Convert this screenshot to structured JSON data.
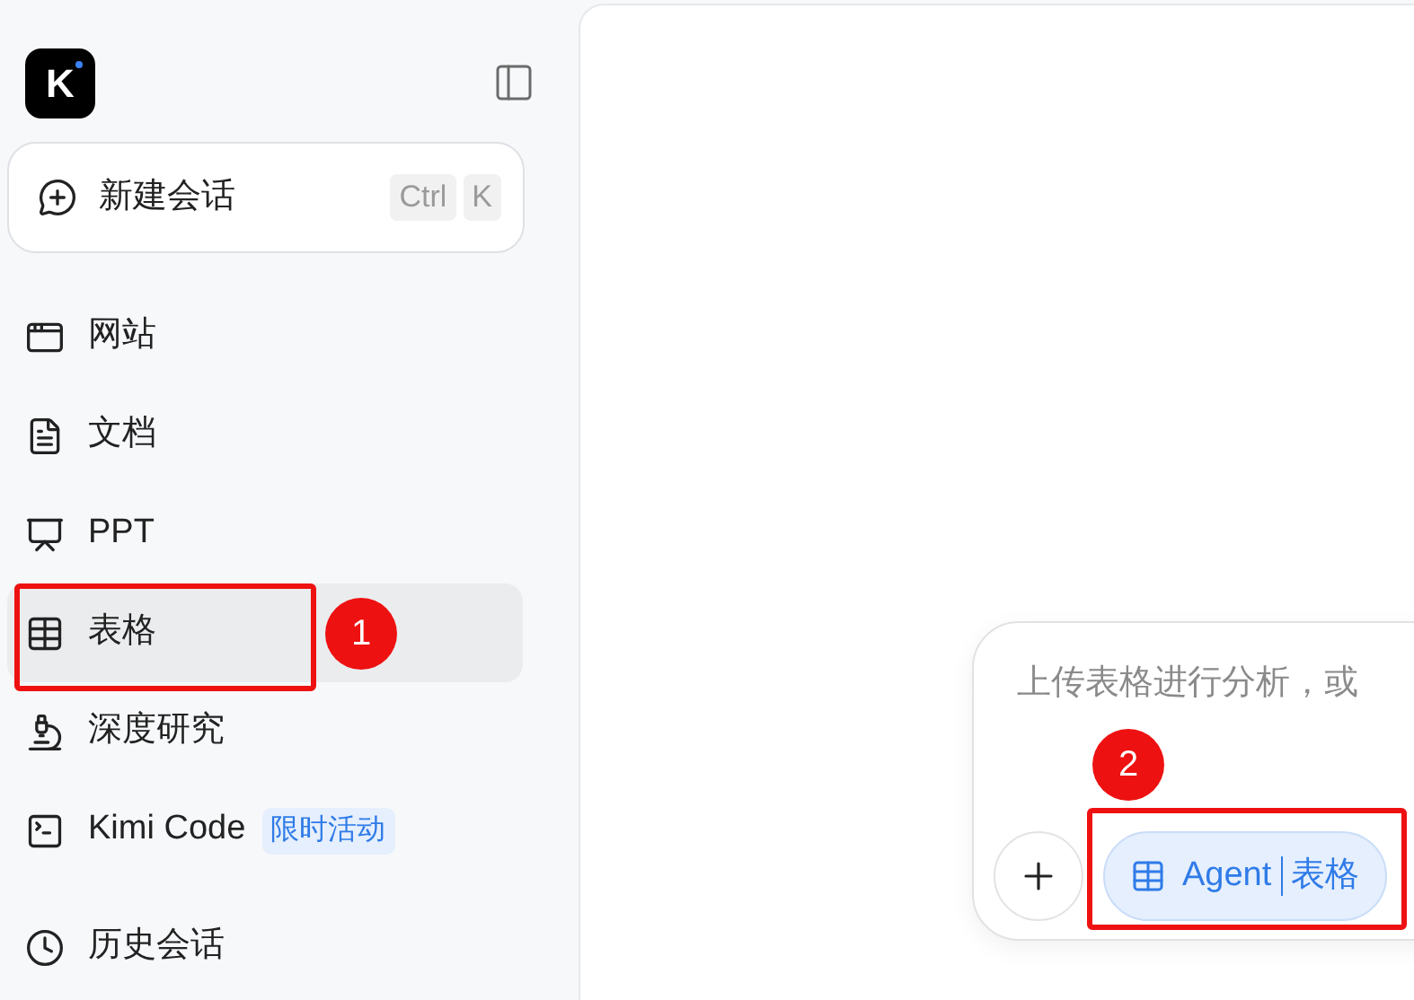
{
  "logo": {
    "letter": "K"
  },
  "new_chat": {
    "label": "新建会话",
    "shortcut": [
      "Ctrl",
      "K"
    ]
  },
  "nav": [
    {
      "kind": "website",
      "label": "网站",
      "selected": false
    },
    {
      "kind": "document",
      "label": "文档",
      "selected": false
    },
    {
      "kind": "slides",
      "label": "PPT",
      "selected": false
    },
    {
      "kind": "table",
      "label": "表格",
      "selected": true
    },
    {
      "kind": "research",
      "label": "深度研究",
      "selected": false
    },
    {
      "kind": "code",
      "label": "Kimi Code",
      "badge": "限时活动",
      "selected": false
    },
    {
      "kind": "history",
      "label": "历史会话",
      "selected": false
    }
  ],
  "composer": {
    "placeholder": "上传表格进行分析，或",
    "agent": {
      "label": "Agent",
      "mode": "表格"
    }
  },
  "annotations": [
    {
      "number": "1"
    },
    {
      "number": "2"
    }
  ]
}
